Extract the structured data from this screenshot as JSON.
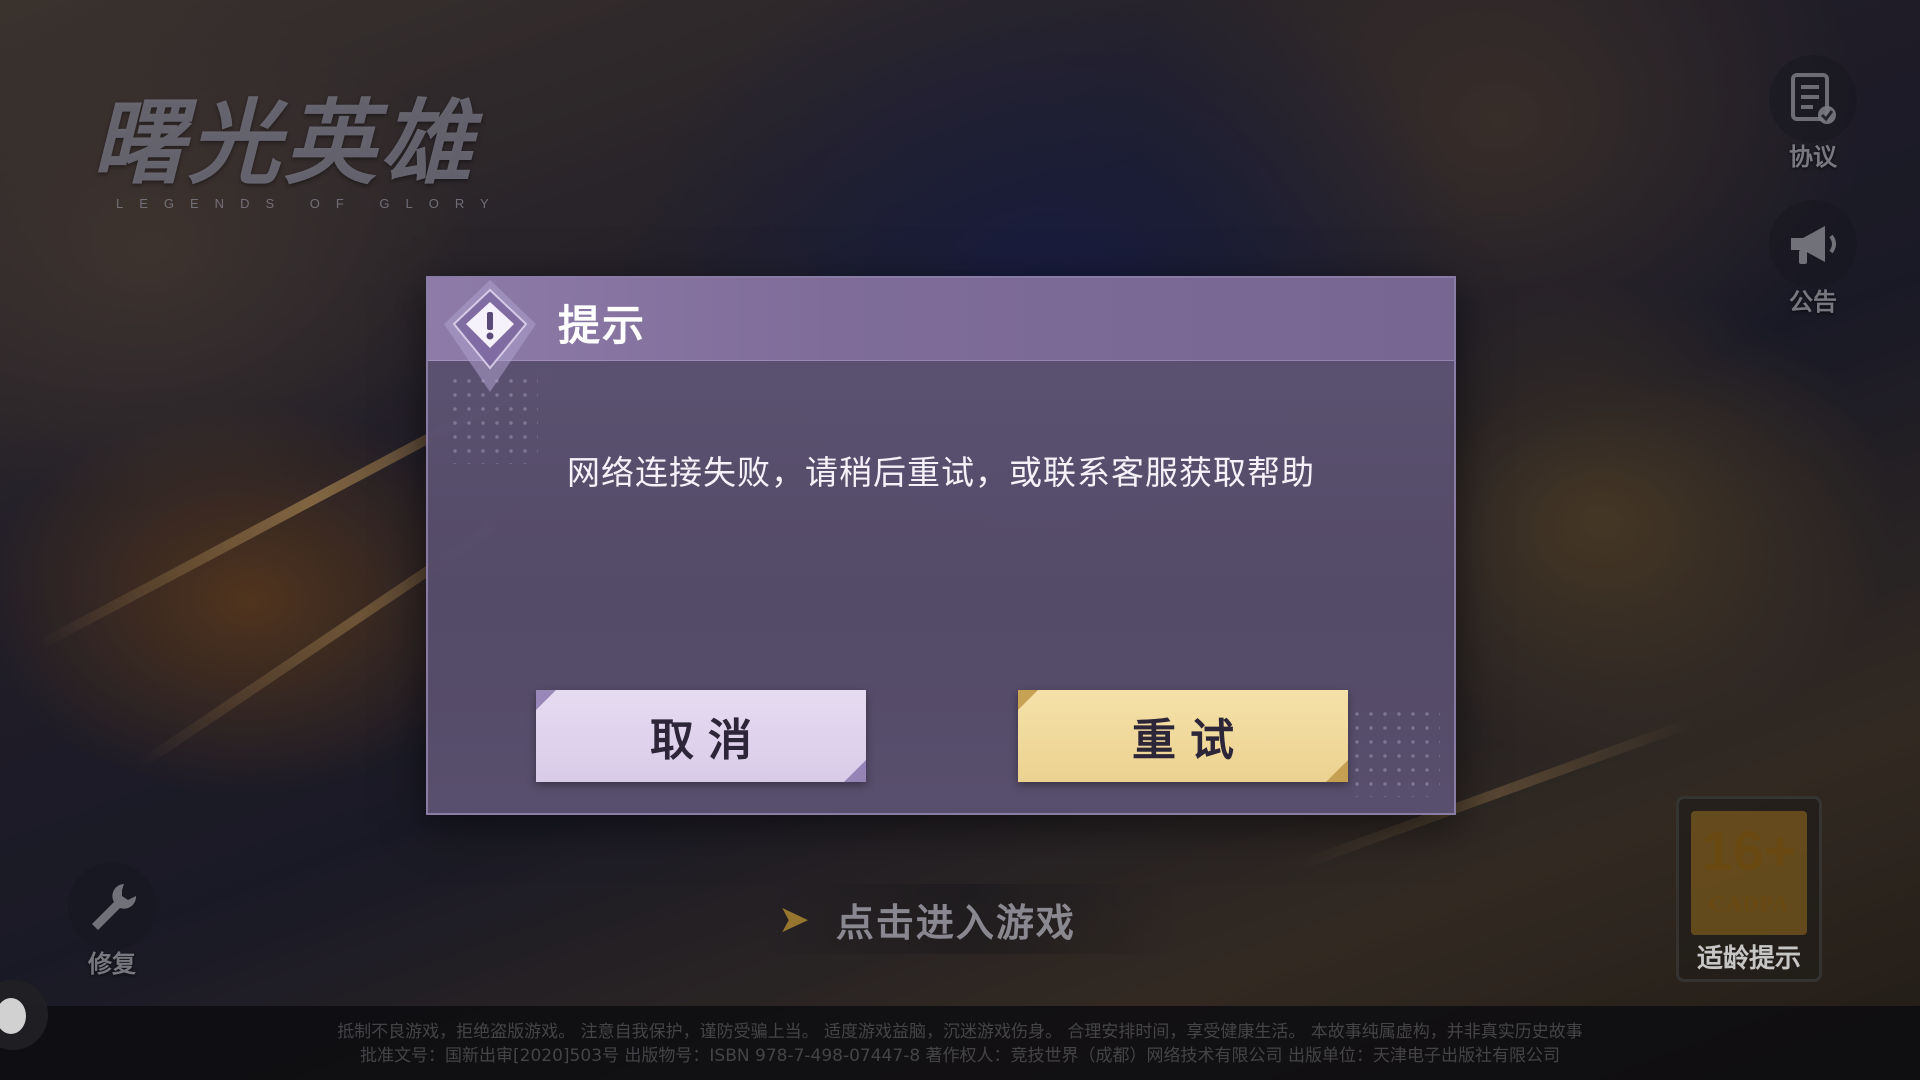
{
  "app": {
    "logo_title": "曙光英雄",
    "logo_subtitle": "LEGENDS OF GLORY"
  },
  "side_buttons": {
    "agreement_label": "协议",
    "notice_label": "公告",
    "repair_label": "修复"
  },
  "age_rating": {
    "age": "16+",
    "org": "CADPA",
    "label": "适龄提示"
  },
  "enter_game": {
    "label": "点击进入游戏"
  },
  "legal": {
    "line1": "抵制不良游戏，拒绝盗版游戏。 注意自我保护，谨防受骗上当。 适度游戏益脑，沉迷游戏伤身。 合理安排时间，享受健康生活。 本故事纯属虚构，并非真实历史故事",
    "line2": "批准文号：国新出审[2020]503号  出版物号：ISBN 978-7-498-07447-8  著作权人：竞技世界（成都）网络技术有限公司  出版单位：天津电子出版社有限公司"
  },
  "dialog": {
    "title": "提示",
    "message": "网络连接失败，请稍后重试，或联系客服获取帮助",
    "cancel_label": "取消",
    "retry_label": "重试"
  },
  "colors": {
    "dialog_header": "#8e7ba8",
    "cancel_button": "#e6dcf1",
    "retry_button": "#f5e1a8",
    "accent_gold": "#b8903a"
  },
  "icons": {
    "agreement": "document-check-icon",
    "notice": "megaphone-icon",
    "repair": "wrench-icon",
    "dialog": "warning-diamond-icon",
    "enter": "chevron-right-icon"
  }
}
